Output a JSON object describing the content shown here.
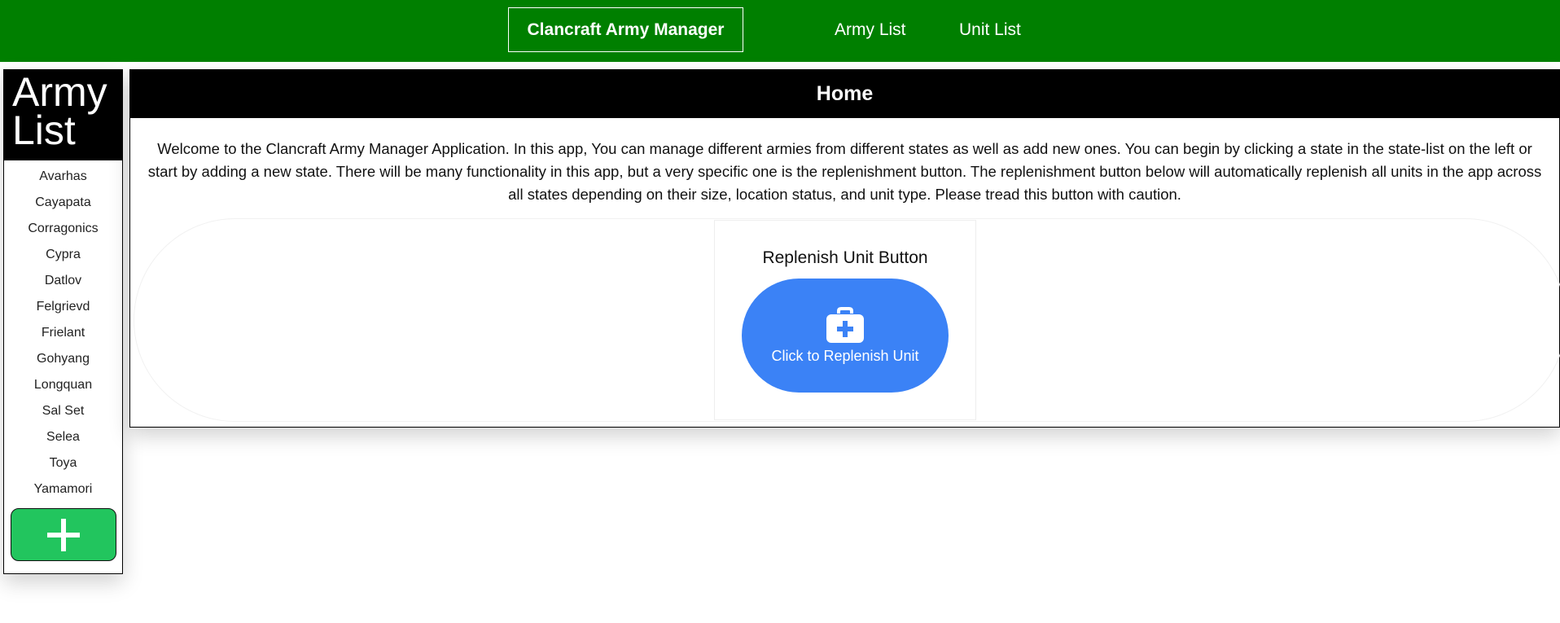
{
  "navbar": {
    "brand": "Clancraft Army Manager",
    "links": [
      "Army List",
      "Unit List"
    ]
  },
  "sidebar": {
    "title": "Army List",
    "states": [
      "Avarhas",
      "Cayapata",
      "Corragonics",
      "Cypra",
      "Datlov",
      "Felgrievd",
      "Frielant",
      "Gohyang",
      "Longquan",
      "Sal Set",
      "Selea",
      "Toya",
      "Yamamori"
    ],
    "add_icon": "plus-icon"
  },
  "main": {
    "title": "Home",
    "intro": "Welcome to the Clancraft Army Manager Application. In this app, You can manage different armies from different states as well as add new ones. You can begin by clicking a state in the state-list on the left or start by adding a new state. There will be many functionality in this app, but a very specific one is the replenishment button. The replenishment button below will automatically replenish all units in the app across all states depending on their size, location status, and unit type. Please tread this button with caution.",
    "replenish": {
      "title": "Replenish Unit Button",
      "button_label": "Click to Replenish Unit",
      "icon": "medical-kit-icon"
    }
  },
  "colors": {
    "navbar": "#007f00",
    "add_button": "#22c55e",
    "replenish_button": "#3b82f6",
    "header": "#000000"
  }
}
